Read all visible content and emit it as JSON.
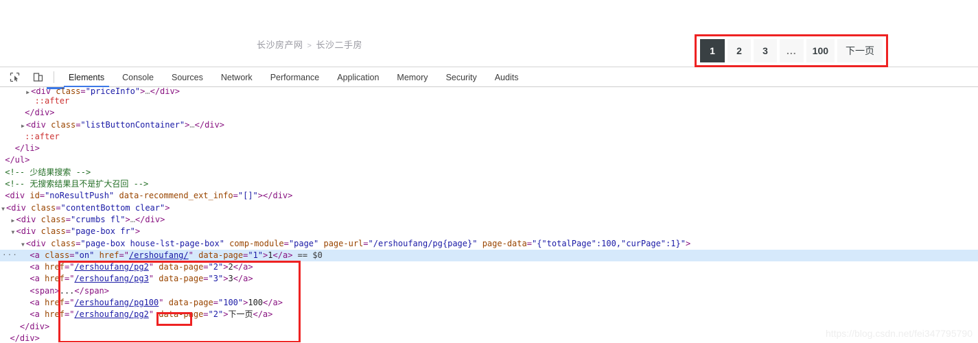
{
  "page": {
    "breadcrumb": {
      "root": "长沙房产网",
      "separator": ">",
      "current": "长沙二手房"
    },
    "pagination": {
      "items": [
        {
          "label": "1",
          "active": true
        },
        {
          "label": "2",
          "active": false
        },
        {
          "label": "3",
          "active": false
        },
        {
          "label": "...",
          "active": false
        },
        {
          "label": "100",
          "active": false
        },
        {
          "label": "下一页",
          "active": false
        }
      ],
      "active_bg": "#394043",
      "item_bg": "#f7f7f7",
      "highlight_border": "#ee2222"
    }
  },
  "devtools": {
    "icons": {
      "inspect": "inspect-element-icon",
      "device": "device-toolbar-icon"
    },
    "tabs": [
      {
        "label": "Elements",
        "active": true
      },
      {
        "label": "Console",
        "active": false
      },
      {
        "label": "Sources",
        "active": false
      },
      {
        "label": "Network",
        "active": false
      },
      {
        "label": "Performance",
        "active": false
      },
      {
        "label": "Application",
        "active": false
      },
      {
        "label": "Memory",
        "active": false
      },
      {
        "label": "Security",
        "active": false
      },
      {
        "label": "Audits",
        "active": false
      }
    ],
    "gutter_badge": "···",
    "code": {
      "l01_tag": "div",
      "l01_attr": "class",
      "l01_val": "\"priceInfo\"",
      "l02_pseudo": "::after",
      "l03_close": "</div>",
      "l04_tag": "div",
      "l04_attr": "class",
      "l04_val": "\"listButtonContainer\"",
      "l05_pseudo": "::after",
      "l06_close": "</li>",
      "l07_close": "</ul>",
      "l08_comment": "<!-- 少结果搜索 -->",
      "l09_comment": "<!-- 无搜索结果且不是扩大召回 -->",
      "l10_tag": "div",
      "l10_attr1": "id",
      "l10_val1": "\"noResultPush\"",
      "l10_attr2": "data-recommend_ext_info",
      "l10_val2": "\"[]\"",
      "l11_tag": "div",
      "l11_attr": "class",
      "l11_val": "\"contentBottom clear\"",
      "l12_tag": "div",
      "l12_attr": "class",
      "l12_val": "\"crumbs fl\"",
      "l13_tag": "div",
      "l13_attr": "class",
      "l13_val": "\"page-box fr\"",
      "l14_tag": "div",
      "l14_attr1": "class",
      "l14_val1": "\"page-box house-lst-page-box\"",
      "l14_attr2": "comp-module",
      "l14_val2": "\"page\"",
      "l14_attr3": "page-url",
      "l14_val3": "\"/ershoufang/pg{page}\"",
      "l14_attr4": "page-data",
      "l14_val4": "\"{\"totalPage\":100,\"curPage\":1}\"",
      "l15_attr1": "class",
      "l15_val1": "\"on\"",
      "l15_attr2": "href",
      "l15_href": "/ershoufang/",
      "l15_attr3": "data-page",
      "l15_val3": "\"1\"",
      "l15_text": "1",
      "l15_selected": "== $0",
      "l16_href": "/ershoufang/pg2",
      "l16_val": "\"2\"",
      "l16_text": "2",
      "l17_href": "/ershoufang/pg3",
      "l17_val": "\"3\"",
      "l17_text": "3",
      "l18_span": "<span>...</span>",
      "l19_href_base": "/ershoufang",
      "l19_href_hl": "/pg100",
      "l19_val": "\"100\"",
      "l19_text": "100",
      "l20_href": "/ershoufang/pg2",
      "l20_val": "\"2\"",
      "l20_text": "下一页",
      "l21_close": "</div>",
      "l22_close": "</div>"
    }
  },
  "watermark": "https://blog.csdn.net/fei347795790"
}
